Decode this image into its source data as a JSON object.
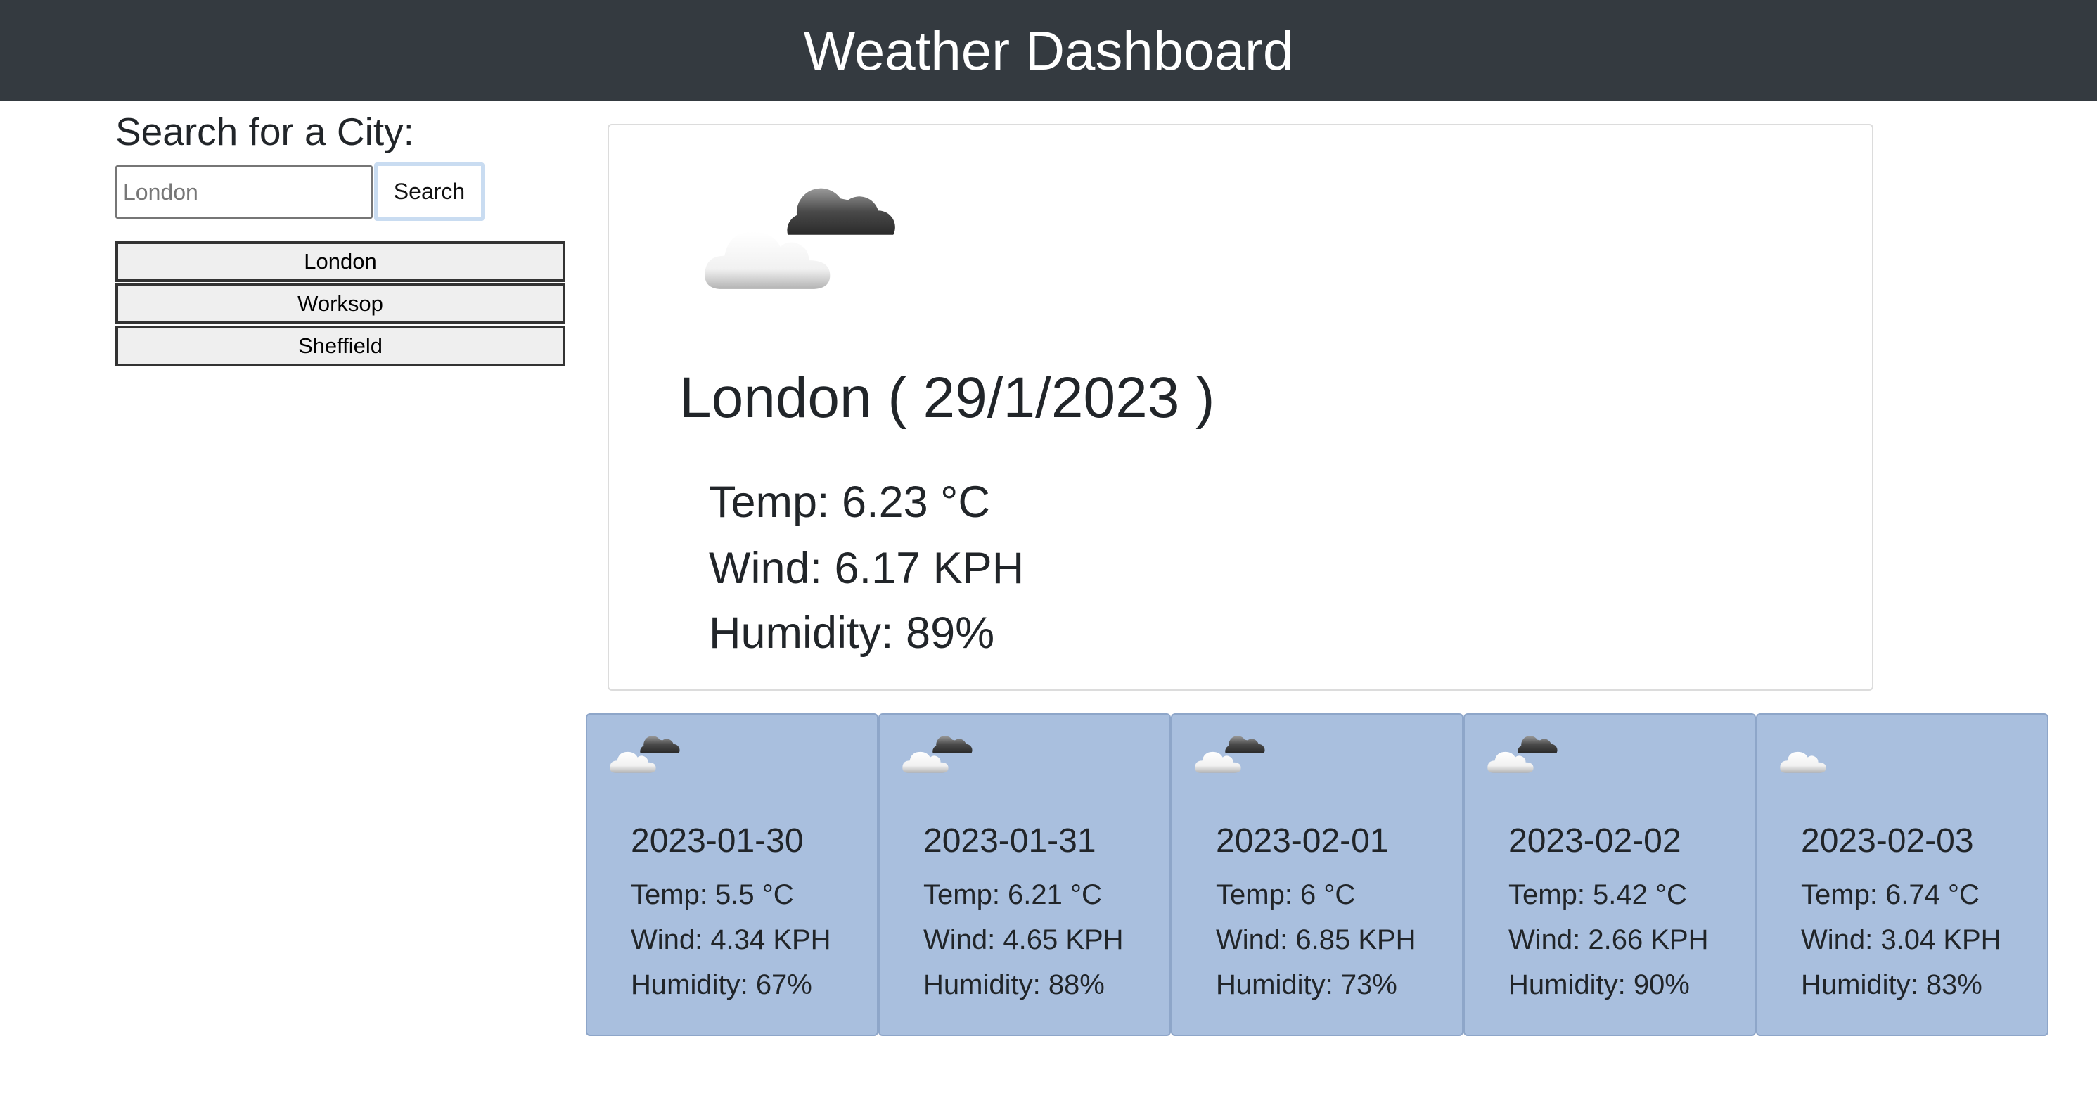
{
  "header": {
    "title": "Weather Dashboard"
  },
  "search": {
    "title": "Search for a City:",
    "placeholder": "London",
    "button_label": "Search"
  },
  "history": [
    "London",
    "Worksop",
    "Sheffield"
  ],
  "current": {
    "city": "London",
    "date": "29/1/2023",
    "title": "London ( 29/1/2023 )",
    "icon": "partly-cloudy-icon",
    "temp": "Temp: 6.23 °C",
    "wind": "Wind: 6.17 KPH",
    "humidity": "Humidity: 89%"
  },
  "forecast": [
    {
      "date": "2023-01-30",
      "icon": "partly-cloudy-icon",
      "temp": "Temp: 5.5 °C",
      "wind": "Wind: 4.34 KPH",
      "humidity": "Humidity: 67%"
    },
    {
      "date": "2023-01-31",
      "icon": "partly-cloudy-icon",
      "temp": "Temp: 6.21 °C",
      "wind": "Wind: 4.65 KPH",
      "humidity": "Humidity: 88%"
    },
    {
      "date": "2023-02-01",
      "icon": "partly-cloudy-icon",
      "temp": "Temp: 6 °C",
      "wind": "Wind: 6.85 KPH",
      "humidity": "Humidity: 73%"
    },
    {
      "date": "2023-02-02",
      "icon": "partly-cloudy-icon",
      "temp": "Temp: 5.42 °C",
      "wind": "Wind: 2.66 KPH",
      "humidity": "Humidity: 90%"
    },
    {
      "date": "2023-02-03",
      "icon": "cloud-icon",
      "temp": "Temp: 6.74 °C",
      "wind": "Wind: 3.04 KPH",
      "humidity": "Humidity: 83%"
    }
  ],
  "colors": {
    "header_bg": "#343a40",
    "forecast_card_bg": "#a9bfde"
  }
}
